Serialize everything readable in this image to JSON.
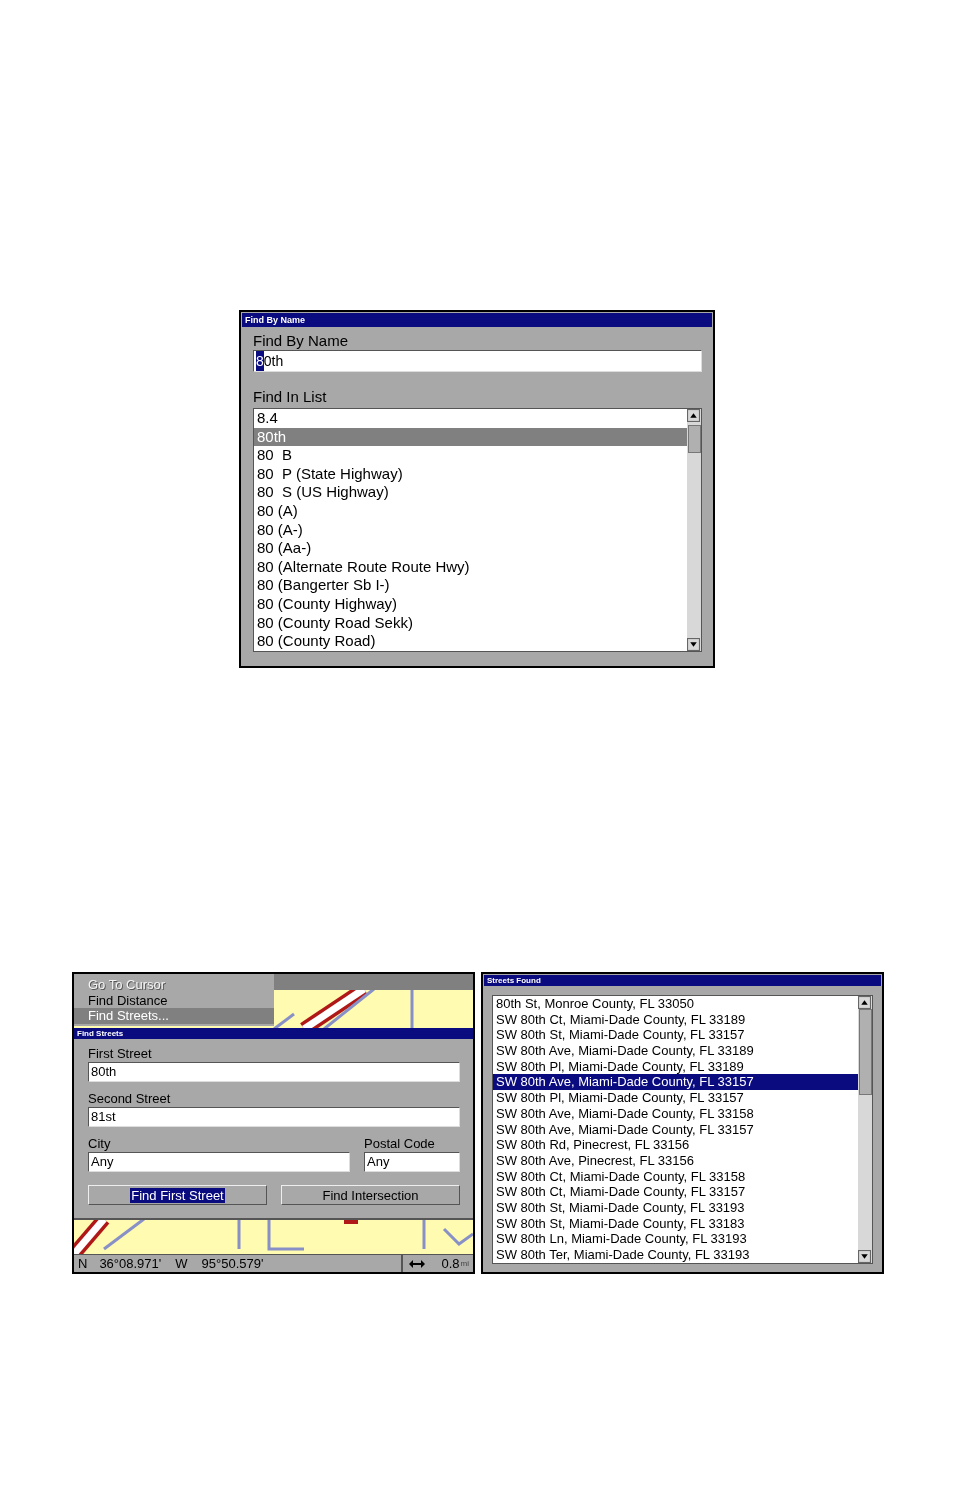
{
  "find_by_name": {
    "title": "Find By Name",
    "field_label": "Find By Name",
    "field": {
      "value": "80th",
      "cursor": true
    },
    "list_label": "Find In List",
    "items": [
      {
        "label": "8.4",
        "selected": false
      },
      {
        "label": "80th",
        "selected": true
      },
      {
        "label": "80  B",
        "selected": false
      },
      {
        "label": "80  P (State Highway)",
        "selected": false
      },
      {
        "label": "80  S (US Highway)",
        "selected": false
      },
      {
        "label": "80 (A)",
        "selected": false
      },
      {
        "label": "80 (A-)",
        "selected": false
      },
      {
        "label": "80 (Aa-)",
        "selected": false
      },
      {
        "label": "80 (Alternate Route Route Hwy)",
        "selected": false
      },
      {
        "label": "80 (Bangerter Sb I-)",
        "selected": false
      },
      {
        "label": "80 (County Highway)",
        "selected": false
      },
      {
        "label": "80 (County Road Sekk)",
        "selected": false
      },
      {
        "label": "80 (County Road)",
        "selected": false
      }
    ]
  },
  "find_streets": {
    "menu": [
      {
        "label": "Go To Cursor",
        "disabled": true,
        "selected": false
      },
      {
        "label": "Find Distance",
        "disabled": false,
        "selected": false
      },
      {
        "label": "Find Streets...",
        "disabled": false,
        "selected": true
      }
    ],
    "title": "Find Streets",
    "first_street": {
      "label": "First Street",
      "value": "80th"
    },
    "second_street": {
      "label": "Second Street",
      "value": "81st"
    },
    "city": {
      "label": "City",
      "value": "Any"
    },
    "postal_code": {
      "label": "Postal Code",
      "value": "Any"
    },
    "buttons": [
      {
        "label": "Find First Street",
        "selected": true
      },
      {
        "label": "Find Intersection",
        "selected": false
      }
    ],
    "status_bar": {
      "lat_hemisphere": "N",
      "latitude": "36°08.971'",
      "lon_hemisphere": "W",
      "longitude": "95°50.579'",
      "scale": "0.8",
      "scale_unit": "mi"
    }
  },
  "streets_found": {
    "title": "Streets Found",
    "items": [
      {
        "label": "80th St, Monroe County, FL 33050",
        "selected": false
      },
      {
        "label": "SW 80th Ct, Miami-Dade County, FL 33189",
        "selected": false
      },
      {
        "label": "SW 80th St, Miami-Dade County, FL 33157",
        "selected": false
      },
      {
        "label": "SW 80th Ave, Miami-Dade County, FL 33189",
        "selected": false
      },
      {
        "label": "SW 80th Pl, Miami-Dade County, FL 33189",
        "selected": false
      },
      {
        "label": "SW 80th Ave, Miami-Dade County, FL 33157",
        "selected": true
      },
      {
        "label": "SW 80th Pl, Miami-Dade County, FL 33157",
        "selected": false
      },
      {
        "label": "SW 80th Ave, Miami-Dade County, FL 33158",
        "selected": false
      },
      {
        "label": "SW 80th Ave, Miami-Dade County, FL 33157",
        "selected": false
      },
      {
        "label": "SW 80th Rd, Pinecrest, FL 33156",
        "selected": false
      },
      {
        "label": "SW 80th Ave, Pinecrest, FL 33156",
        "selected": false
      },
      {
        "label": "SW 80th Ct, Miami-Dade County, FL 33158",
        "selected": false
      },
      {
        "label": "SW 80th Ct, Miami-Dade County, FL 33157",
        "selected": false
      },
      {
        "label": "SW 80th St, Miami-Dade County, FL 33193",
        "selected": false
      },
      {
        "label": "SW 80th St, Miami-Dade County, FL 33183",
        "selected": false
      },
      {
        "label": "SW 80th Ln, Miami-Dade County, FL 33193",
        "selected": false
      },
      {
        "label": "SW 80th Ter, Miami-Dade County, FL 33193",
        "selected": false
      }
    ]
  }
}
